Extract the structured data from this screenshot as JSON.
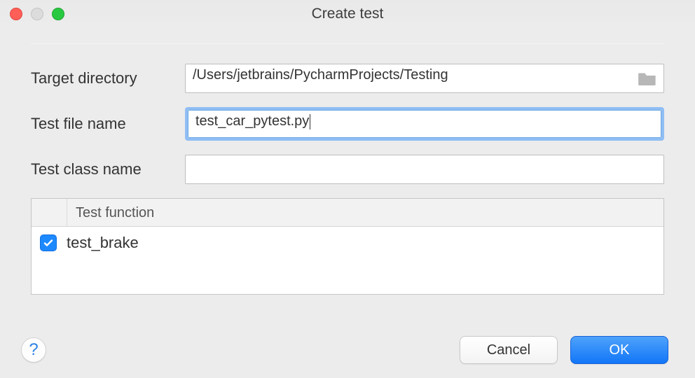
{
  "window": {
    "title": "Create test"
  },
  "form": {
    "target_directory_label": "Target directory",
    "target_directory_value": "/Users/jetbrains/PycharmProjects/Testing",
    "test_file_name_label": "Test file name",
    "test_file_name_value": "test_car_pytest.py",
    "test_class_name_label": "Test class name",
    "test_class_name_value": ""
  },
  "table": {
    "header": "Test function",
    "rows": [
      {
        "checked": true,
        "name": "test_brake"
      }
    ]
  },
  "footer": {
    "help_tooltip": "Help",
    "cancel_label": "Cancel",
    "ok_label": "OK"
  }
}
